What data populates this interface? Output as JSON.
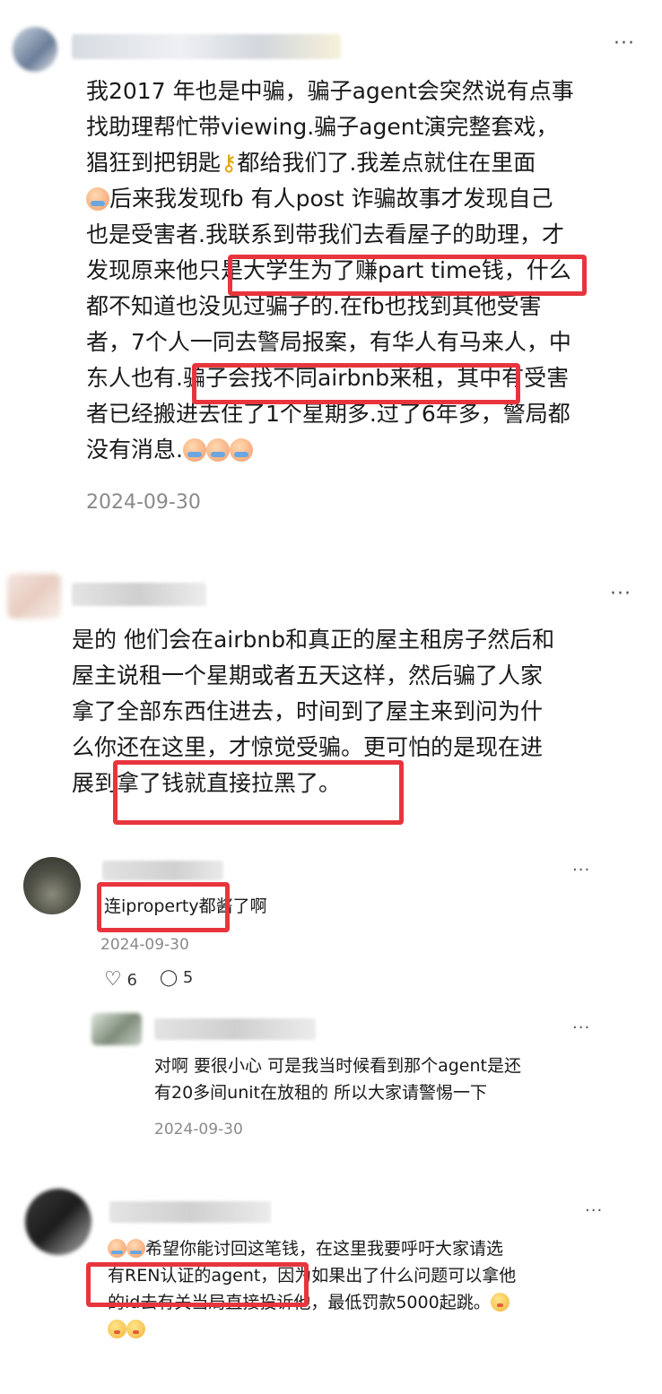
{
  "comments": [
    {
      "text_lines": [
        "我2017 年也是中骗，骗子agent会突然说有点事",
        "找助理帮忙带viewing.骗子agent演完整套戏，",
        "猖狂到把钥匙",
        "都给我们了.我差点就住在里面",
        "后来我发现fb 有人post 诈骗故事才发现自己",
        "也是受害者.我联系到带我们去看屋子的助理，才",
        "发现原来他只是大学生为了赚part time钱，什么",
        "都不知道也没见过骗子的.在fb也找到其他受害",
        "者，7个人一同去警局报案，有华人有马来人，中",
        "东人也有.骗子会找不同airbnb来租，其中有受害",
        "者已经搬进去住了1个星期多.过了6年多，警局都",
        "没有消息."
      ],
      "date": "2024-09-30"
    },
    {
      "text_lines": [
        "是的 他们会在airbnb和真正的屋主租房子然后和",
        "屋主说租一个星期或者五天这样，然后骗了人家",
        "拿了全部东西住进去，时间到了屋主来到问为什",
        "么你还在这里，才惊觉受骗。更可怕的是现在进",
        "展到拿了钱就直接拉黑了。"
      ]
    }
  ],
  "replies": [
    {
      "text": "连iproperty都酱了啊",
      "date": "2024-09-30",
      "likes": "6",
      "replies_count": "5"
    },
    {
      "text_lines": [
        "对啊 要很小心 可是我当时候看到那个agent是还",
        "有20多间unit在放租的 所以大家请警惕一下"
      ],
      "date": "2024-09-30"
    },
    {
      "text_lines": [
        "希望你能讨回这笔钱，在这里我要呼吁大家请选",
        "有REN认证的agent，因为如果出了什么问题可以拿他",
        "的id去有关当局直接投诉他，最低罚款5000起跳。"
      ]
    }
  ],
  "ui": {
    "more_label": "···",
    "heart_icon": "♡",
    "comment_icon": "◯"
  },
  "colors": {
    "highlight": "#e8353d",
    "date": "#8a8a8a",
    "text": "#1a1a1a"
  }
}
